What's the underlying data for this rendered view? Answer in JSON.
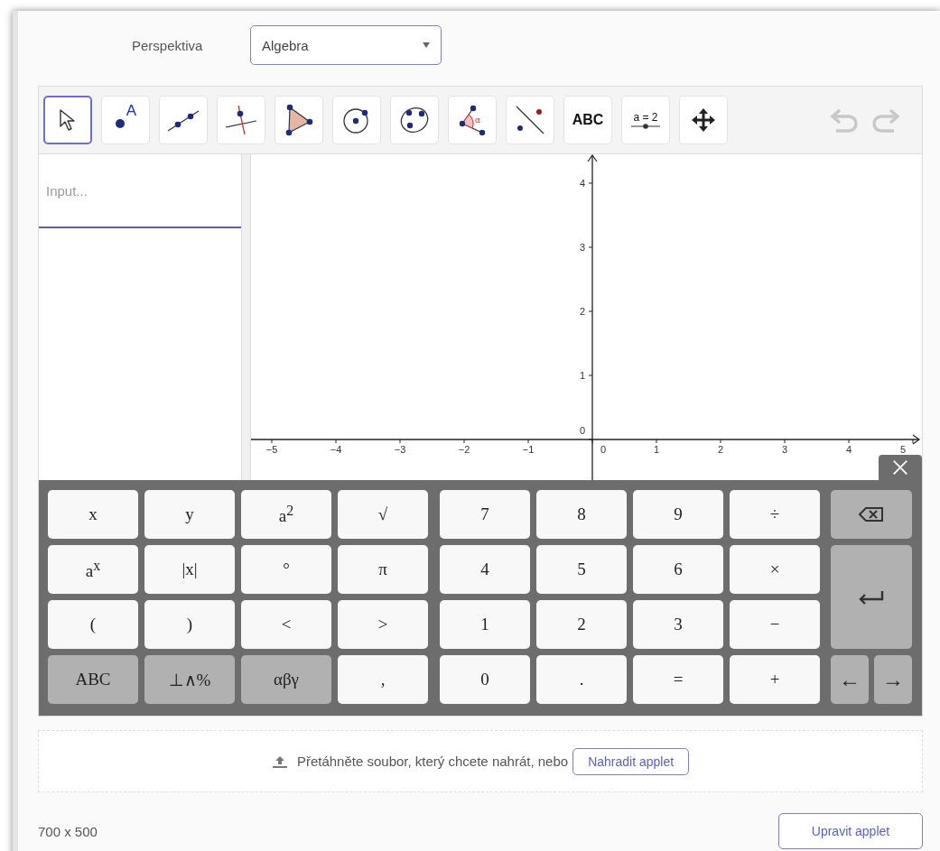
{
  "perspective": {
    "label": "Perspektiva",
    "value": "Algebra"
  },
  "toolbar": {
    "tools": [
      {
        "kind": "move",
        "selected": true
      },
      {
        "kind": "point",
        "label": "A",
        "selected": false
      },
      {
        "kind": "line",
        "selected": false
      },
      {
        "kind": "perpendicular",
        "selected": false
      },
      {
        "kind": "polygon",
        "selected": false
      },
      {
        "kind": "circle",
        "selected": false
      },
      {
        "kind": "conic",
        "selected": false
      },
      {
        "kind": "angle",
        "label": "α",
        "selected": false
      },
      {
        "kind": "reflect",
        "selected": false
      },
      {
        "kind": "text",
        "label": "ABC",
        "selected": false
      },
      {
        "kind": "slider",
        "label": "a = 2",
        "selected": false
      },
      {
        "kind": "move-view",
        "selected": false
      }
    ],
    "undo": {
      "disabled": true
    },
    "redo": {
      "disabled": true
    }
  },
  "algebra": {
    "input": {
      "placeholder": "Input..."
    }
  },
  "graphics": {
    "y_labels": [
      "4",
      "3",
      "2",
      "1",
      "0"
    ],
    "x_labels": [
      "−5",
      "−4",
      "−3",
      "−2",
      "−1",
      "0",
      "1",
      "2",
      "3",
      "4",
      "5"
    ]
  },
  "keyboard": {
    "left_keys": [
      {
        "label": "x",
        "kind": "light"
      },
      {
        "label": "y",
        "kind": "light"
      },
      {
        "label": "a$^{2}$",
        "kind": "light"
      },
      {
        "label": "√",
        "kind": "light"
      },
      {
        "label": "a$^{x}$",
        "kind": "light"
      },
      {
        "label": "|x|",
        "kind": "light"
      },
      {
        "label": "°",
        "kind": "light"
      },
      {
        "label": "π",
        "kind": "light"
      },
      {
        "label": "(",
        "kind": "light"
      },
      {
        "label": ")",
        "kind": "light"
      },
      {
        "label": "<",
        "kind": "light"
      },
      {
        "label": ">",
        "kind": "light"
      },
      {
        "label": "ABC",
        "kind": "dark"
      },
      {
        "label": "⊥∧%",
        "kind": "dark"
      },
      {
        "label": "αβγ",
        "kind": "dark"
      },
      {
        "label": ",",
        "kind": "light"
      }
    ],
    "numpad_keys": [
      {
        "label": "7",
        "kind": "light"
      },
      {
        "label": "8",
        "kind": "light"
      },
      {
        "label": "9",
        "kind": "light"
      },
      {
        "label": "÷",
        "kind": "light"
      },
      {
        "label": "4",
        "kind": "light"
      },
      {
        "label": "5",
        "kind": "light"
      },
      {
        "label": "6",
        "kind": "light"
      },
      {
        "label": "×",
        "kind": "light"
      },
      {
        "label": "1",
        "kind": "light"
      },
      {
        "label": "2",
        "kind": "light"
      },
      {
        "label": "3",
        "kind": "light"
      },
      {
        "label": "−",
        "kind": "light"
      },
      {
        "label": "0",
        "kind": "light"
      },
      {
        "label": ".",
        "kind": "light"
      },
      {
        "label": "=",
        "kind": "light"
      },
      {
        "label": "+",
        "kind": "light"
      }
    ],
    "arrows": [
      "←",
      "→"
    ]
  },
  "upload": {
    "text": "Přetáhněte soubor, který chcete nahrát, nebo",
    "button": "Nahradit applet"
  },
  "size": "700 x 500",
  "edit_button": "Upravit applet"
}
